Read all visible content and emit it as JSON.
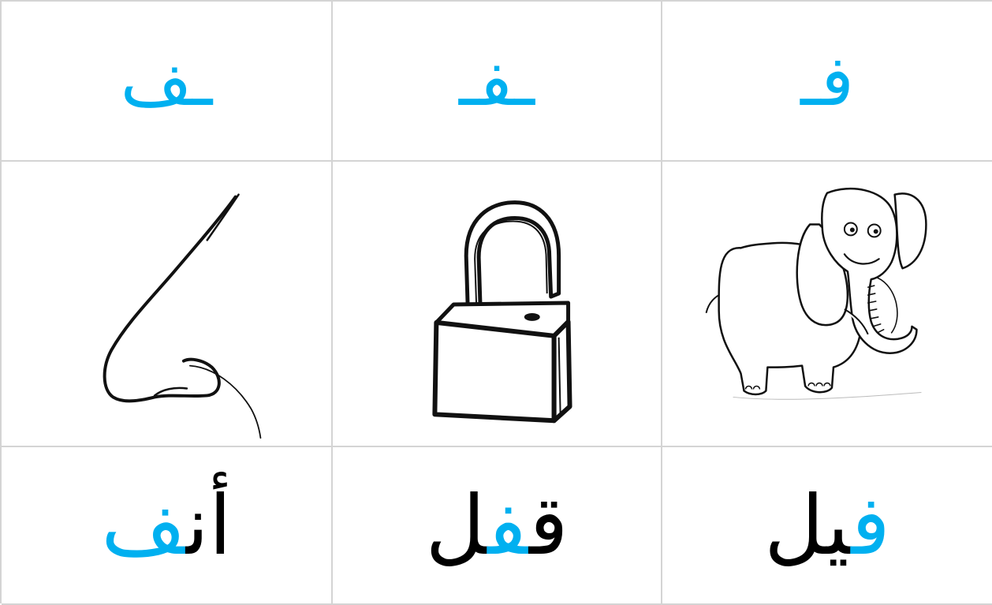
{
  "colors": {
    "accent": "#00b0f0",
    "text": "#000000",
    "gridline": "#d4d4d4"
  },
  "letters": {
    "end": "ـف",
    "middle": "ـفـ",
    "start": "فـ"
  },
  "pictures": {
    "left": "nose-icon",
    "middle": "padlock-icon",
    "right": "elephant-icon"
  },
  "words": {
    "left": {
      "before": "أن",
      "highlight": "ف",
      "after": ""
    },
    "middle": {
      "before": "ق",
      "highlight": "ف",
      "after": "ل"
    },
    "right": {
      "before": "",
      "highlight": "ف",
      "after": "يل"
    }
  }
}
